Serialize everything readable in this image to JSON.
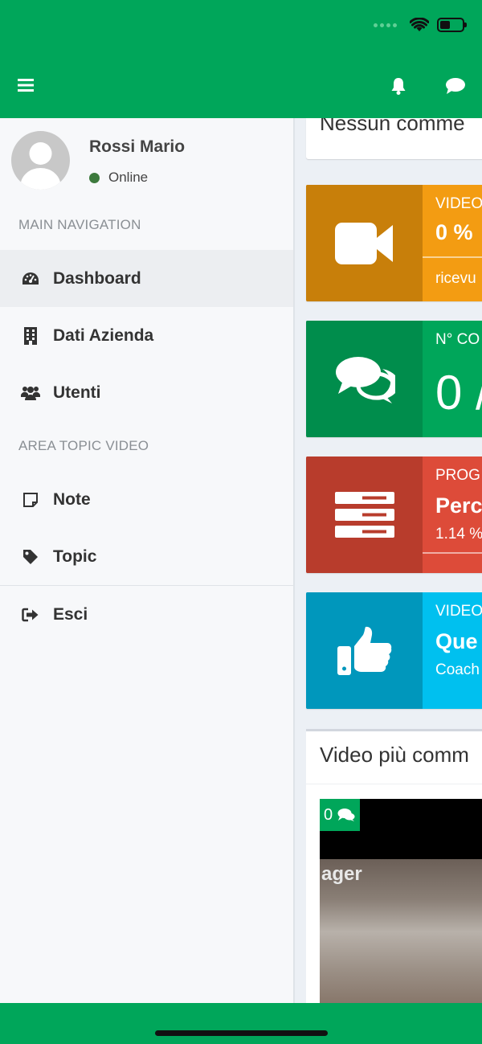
{
  "sidebar": {
    "user": {
      "name": "Rossi Mario",
      "status": "Online"
    },
    "sections": [
      {
        "header": "MAIN NAVIGATION"
      },
      {
        "header": "AREA TOPIC VIDEO"
      }
    ],
    "items": [
      {
        "label": "Dashboard",
        "icon": "dashboard-icon",
        "active": true
      },
      {
        "label": "Dati Azienda",
        "icon": "building-icon"
      },
      {
        "label": "Utenti",
        "icon": "users-icon"
      },
      {
        "label": "Note",
        "icon": "note-icon"
      },
      {
        "label": "Topic",
        "icon": "tag-icon"
      },
      {
        "label": "Esci",
        "icon": "sign-out-icon"
      }
    ]
  },
  "content": {
    "top_card_text": "Nessun comme",
    "boxes": [
      {
        "line1": "VIDEO",
        "big": "0 %",
        "small": "ricevu",
        "icon": "video-camera-icon",
        "icon_color": "#c87f0a",
        "bg_color": "#f39c12"
      },
      {
        "line1": "N° CO",
        "big": "0 /",
        "icon": "comments-icon",
        "icon_color": "#008d4c",
        "bg_color": "#00a65a"
      },
      {
        "line1": "PROG",
        "big": "Perc",
        "small": "1.14 %",
        "icon": "server-icon",
        "icon_color": "#b83c2c",
        "bg_color": "#dd4b39"
      },
      {
        "line1": "VIDEO",
        "big": "Que",
        "small": "Coach",
        "icon": "thumbs-up-icon",
        "icon_color": "#0097bc",
        "bg_color": "#00c0ef"
      }
    ],
    "video_section": {
      "title": "Video più comm",
      "badge_count": "0",
      "thumb_text": "ager"
    }
  },
  "colors": {
    "brand_green": "#00a65a"
  }
}
